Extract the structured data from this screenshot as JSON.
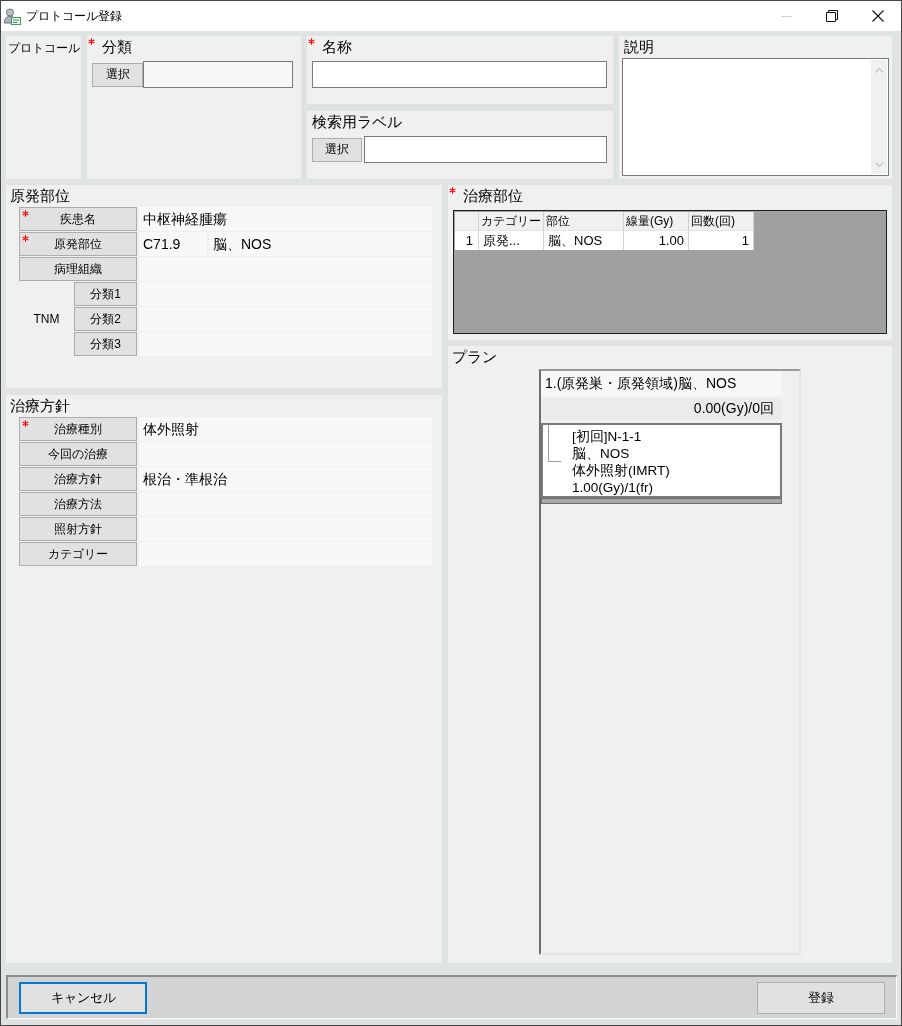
{
  "window": {
    "title": "プロトコール登録",
    "controls": [
      {
        "kind": "minimize",
        "disabled": true
      },
      {
        "kind": "restore",
        "disabled": false
      },
      {
        "kind": "close",
        "disabled": false
      }
    ]
  },
  "protocol": {
    "label": "プロトコール"
  },
  "classification": {
    "label": "分類",
    "required": true,
    "button": "選択"
  },
  "name": {
    "label": "名称",
    "required": true
  },
  "search_label": {
    "label": "検索用ラベル",
    "button": "選択"
  },
  "description": {
    "label": "説明"
  },
  "primary_site": {
    "title": "原発部位",
    "rows": [
      {
        "label": "疾患名",
        "required": true,
        "values": [
          "中枢神経腫瘍"
        ]
      },
      {
        "label": "原発部位",
        "required": true,
        "values": [
          "C71.9",
          "脳、NOS"
        ]
      },
      {
        "label": "病理組織",
        "required": false
      }
    ],
    "tnm": {
      "label": "TNM",
      "rows": [
        {
          "label": "分類1"
        },
        {
          "label": "分類2"
        },
        {
          "label": "分類3"
        }
      ]
    }
  },
  "treatment_policy": {
    "title": "治療方針",
    "rows": [
      {
        "label": "治療種別",
        "required": true,
        "values": [
          "体外照射"
        ]
      },
      {
        "label": "今回の治療",
        "required": false
      },
      {
        "label": "治療方針",
        "required": false,
        "values": [
          "根治・準根治"
        ]
      },
      {
        "label": "治療方法",
        "required": false
      },
      {
        "label": "照射方針",
        "required": false
      },
      {
        "label": "カテゴリー",
        "required": false
      }
    ]
  },
  "treatment_site": {
    "title": "治療部位",
    "required": true,
    "table": {
      "columns": [
        {
          "label": "カテゴリー",
          "kind": "text"
        },
        {
          "label": "部位",
          "kind": "text"
        },
        {
          "label": "線量(Gy)",
          "kind": "number"
        },
        {
          "label": "回数(回)",
          "kind": "number"
        }
      ],
      "rows": [
        {
          "number": "1",
          "cells": [
            "原発...",
            "脳、NOS",
            "1.00",
            "1"
          ]
        }
      ]
    }
  },
  "plan": {
    "title": "プラン",
    "courses": [
      {
        "title": "1.(原発巣・原発領域)脳、NOS",
        "summary": "0.00(Gy)/0回",
        "sessions": [
          {
            "lines": [
              "[初回]N-1-1",
              "脳、NOS",
              "体外照射(IMRT)",
              "1.00(Gy)/1(fr)"
            ]
          }
        ]
      }
    ]
  },
  "buttons": [
    {
      "label": "キャンセル",
      "focused": true
    },
    {
      "label": "登録",
      "focused": false
    }
  ]
}
